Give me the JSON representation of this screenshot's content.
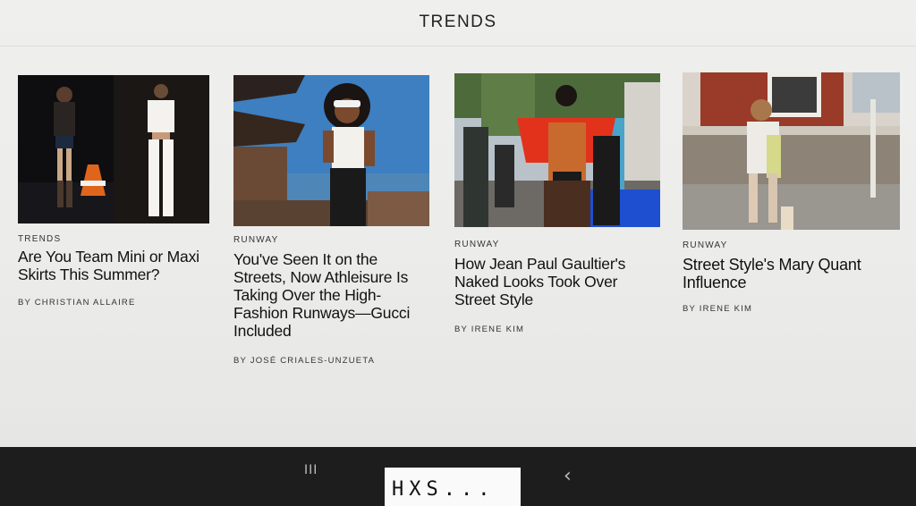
{
  "header": {
    "title": "TRENDS"
  },
  "articles": [
    {
      "kicker": "TRENDS",
      "headline": "Are You Team Mini or Maxi Skirts This Summer?",
      "byline": "BY CHRISTIAN ALLAIRE"
    },
    {
      "kicker": "RUNWAY",
      "headline": "You've Seen It on the Streets, Now Athleisure Is Taking Over the High-Fashion Runways—Gucci Included",
      "byline": "BY JOSÉ CRIALES-UNZUETA"
    },
    {
      "kicker": "RUNWAY",
      "headline": "How Jean Paul Gaultier's Naked Looks Took Over Street Style",
      "byline": "BY IRENE KIM"
    },
    {
      "kicker": "RUNWAY",
      "headline": "Street Style's Mary Quant Influence",
      "byline": "BY IRENE KIM"
    }
  ],
  "nav": {
    "recents_icon": "recents-icon",
    "back_icon": "back-icon",
    "recents_glyph": "III",
    "back_glyph": "‹"
  },
  "watermark": {
    "text": "HXS..."
  }
}
